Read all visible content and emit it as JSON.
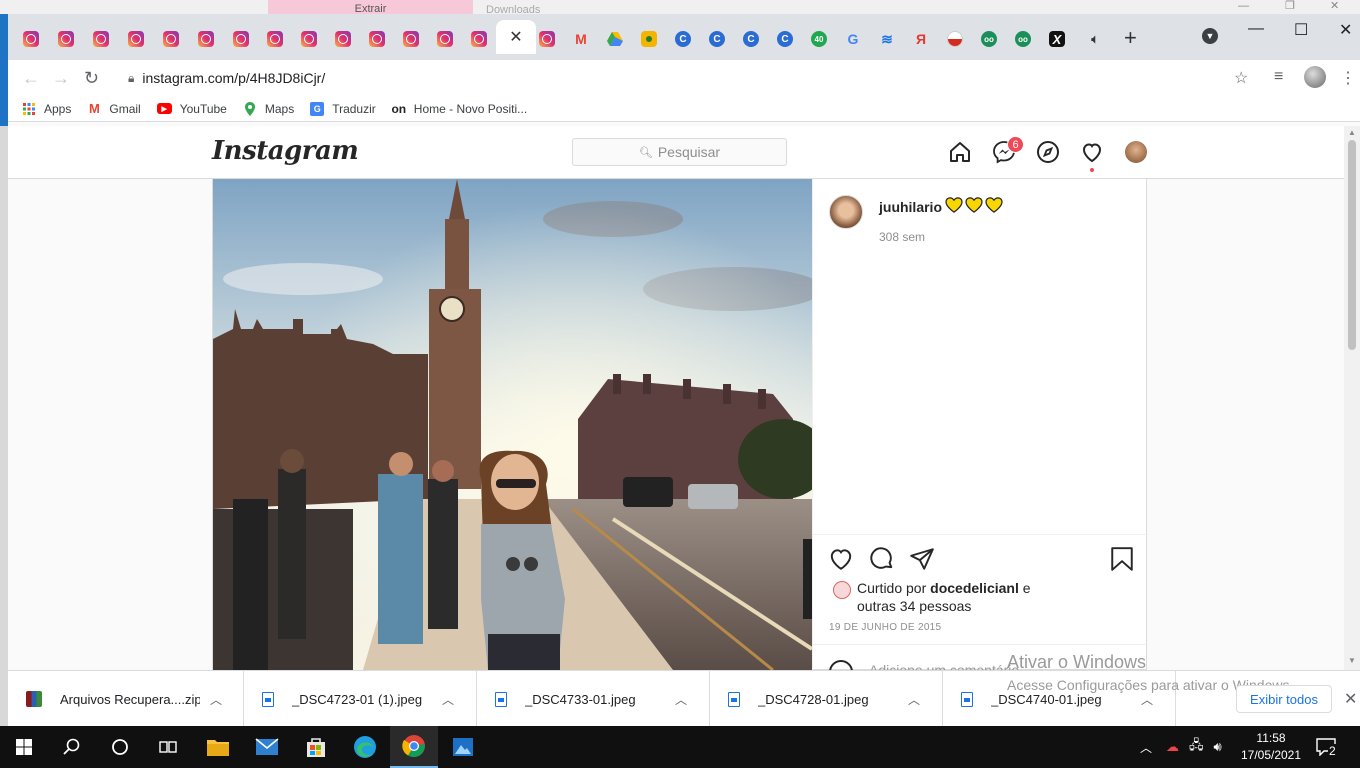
{
  "behind_window": {
    "tab_pink": "Extrair",
    "tab_grey": "Downloads"
  },
  "tabs": {
    "count_instagram_before_active": 14,
    "active_close_label": "✕",
    "new_tab_label": "+"
  },
  "address_bar": {
    "url": "instagram.com/p/4H8JD8iCjr/"
  },
  "bookmarks": [
    {
      "label": "Apps",
      "icon": "apps-grid-icon"
    },
    {
      "label": "Gmail",
      "icon": "gmail-icon"
    },
    {
      "label": "YouTube",
      "icon": "youtube-icon"
    },
    {
      "label": "Maps",
      "icon": "maps-pin-icon"
    },
    {
      "label": "Traduzir",
      "icon": "translate-icon"
    },
    {
      "label": "Home - Novo Positi...",
      "icon": "positivo-icon"
    }
  ],
  "instagram": {
    "logo": "Instagram",
    "search_placeholder": "Pesquisar",
    "messages_badge": "6",
    "post": {
      "author": "juuhilario",
      "age": "308 sem",
      "liked_prefix": "Curtido por",
      "liked_user": "docedelicianl",
      "liked_suffix": "e",
      "liked_others": "outras 34 pessoas",
      "date": "19 DE JUNHO DE 2015",
      "comment_placeholder": "Adicione um comentário..."
    }
  },
  "watermark": {
    "line1": "Ativar o Windows",
    "line2": "Acesse Configurações para ativar o Windows."
  },
  "downloads": {
    "items": [
      {
        "name": "Arquivos Recupera....zip",
        "type": "zip"
      },
      {
        "name": "_DSC4723-01 (1).jpeg",
        "type": "image"
      },
      {
        "name": "_DSC4733-01.jpeg",
        "type": "image"
      },
      {
        "name": "_DSC4728-01.jpeg",
        "type": "image"
      },
      {
        "name": "_DSC4740-01.jpeg",
        "type": "image"
      }
    ],
    "show_all": "Exibir todos"
  },
  "taskbar": {
    "time": "11:58",
    "date": "17/05/2021",
    "notifications": "2"
  },
  "colors": {
    "ig_badge": "#ed4956",
    "chrome_tabstrip": "#dee1e6",
    "link_blue": "#1a73e8",
    "taskbar": "#101010"
  }
}
